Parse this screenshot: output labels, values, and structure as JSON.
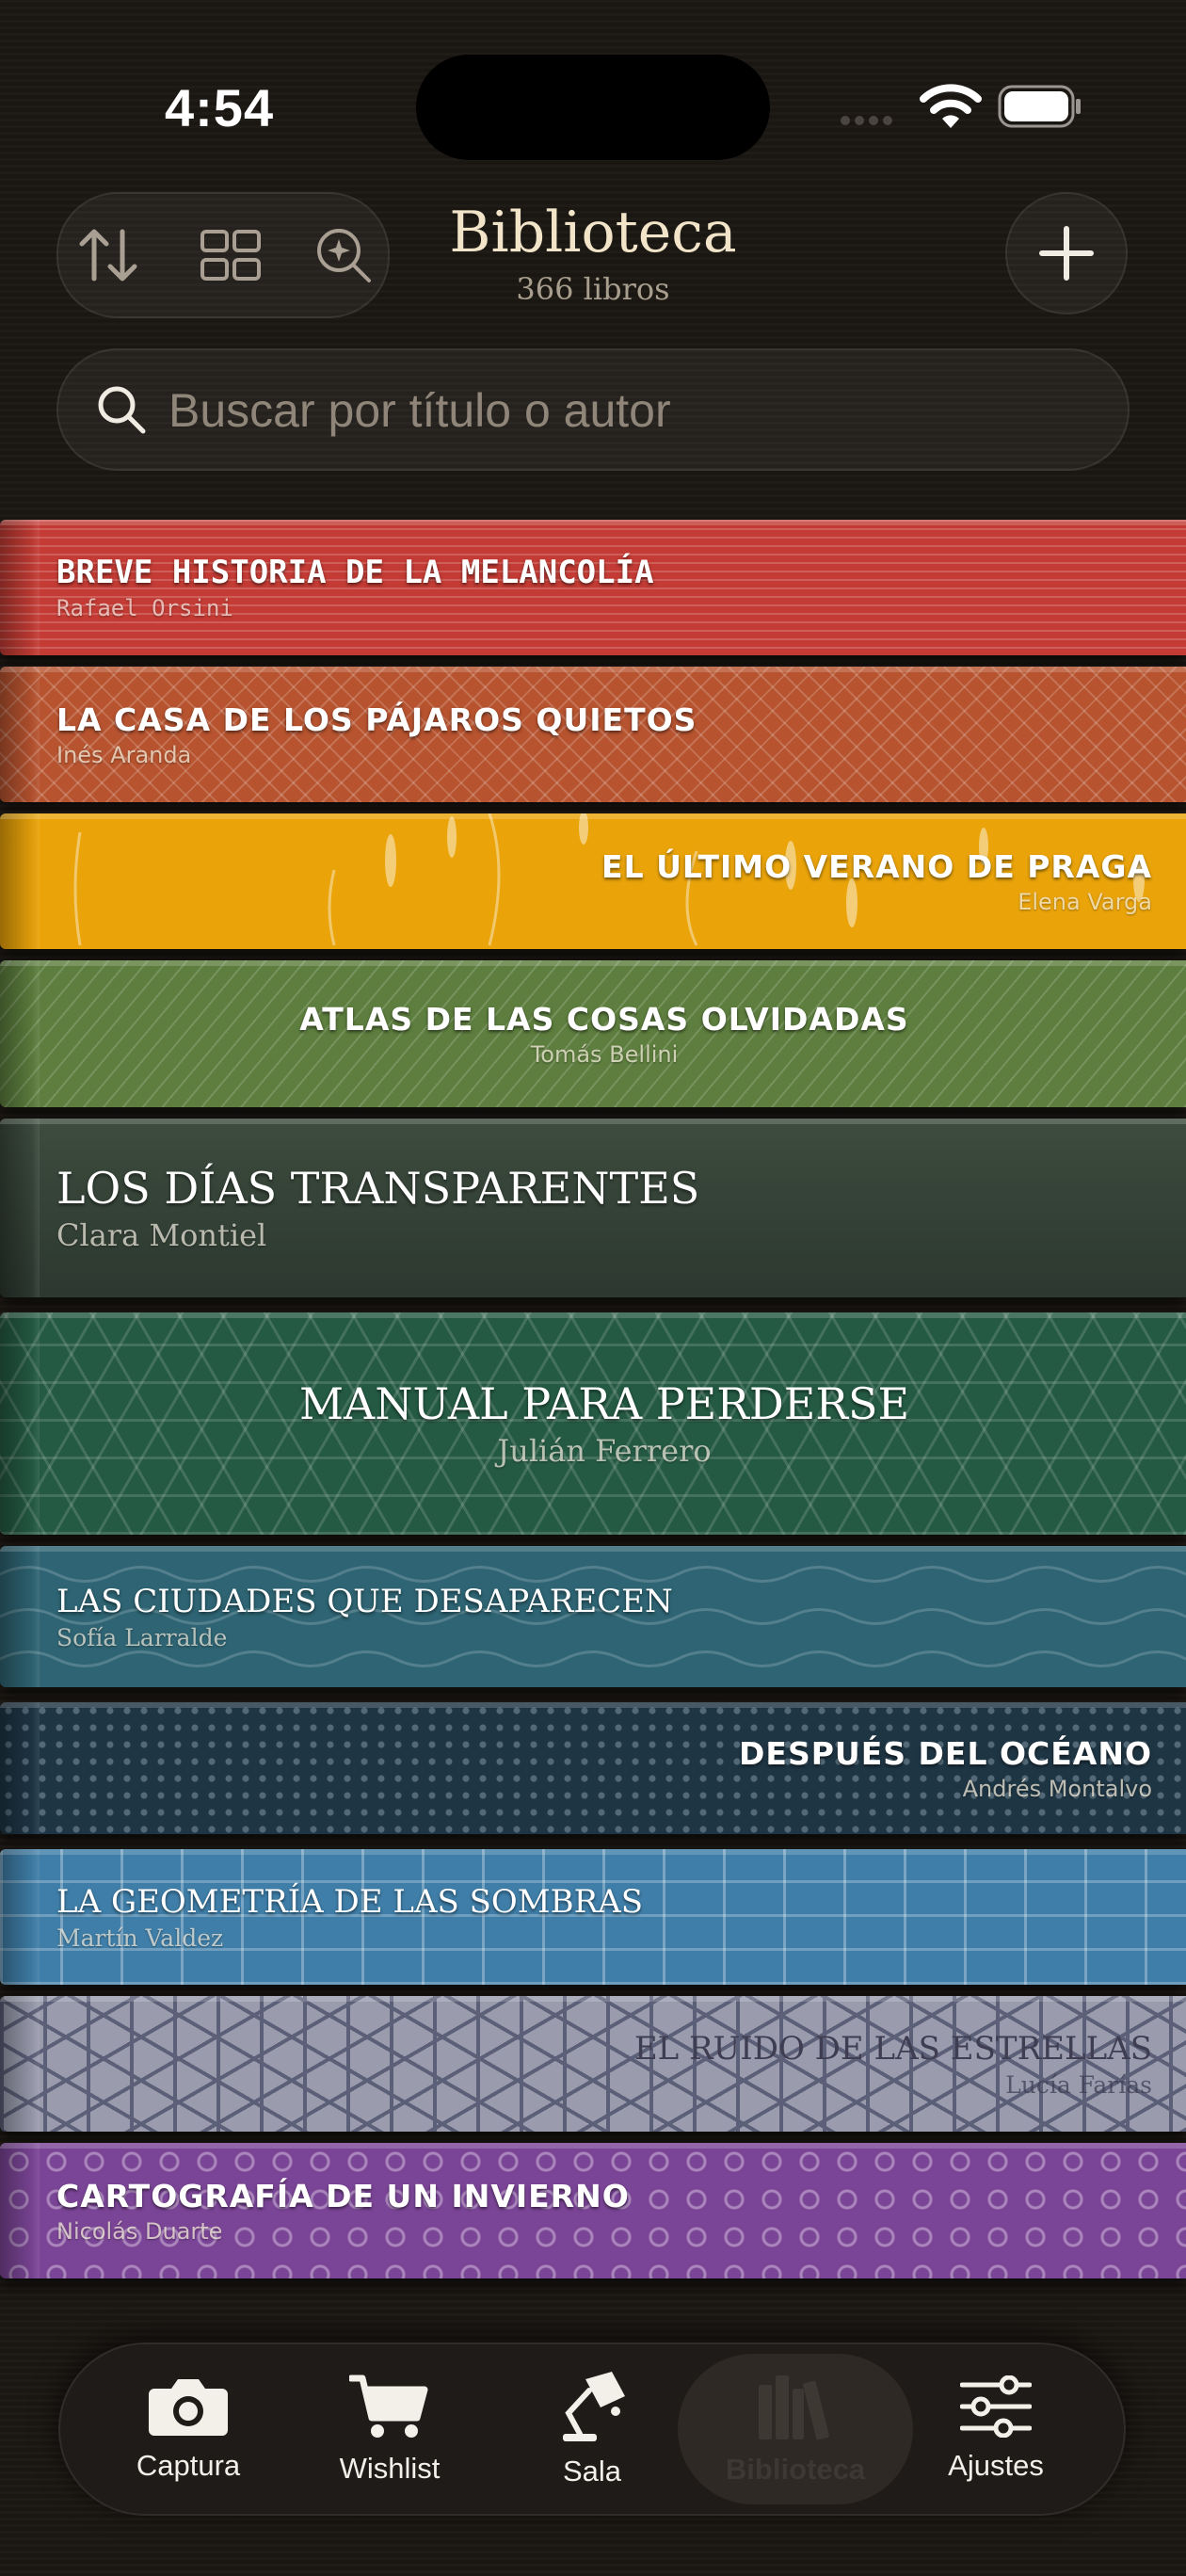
{
  "status_bar": {
    "time": "4:54"
  },
  "header": {
    "title": "Biblioteca",
    "subtitle": "366 libros",
    "tools": [
      "sort-icon",
      "grid-view-icon",
      "zoom-magnify-icon"
    ],
    "add_icon": "plus-icon"
  },
  "search": {
    "placeholder": "Buscar por título o autor",
    "value": ""
  },
  "books": [
    {
      "title": "BREVE HISTORIA DE LA MELANCOLÍA",
      "author": "Rafael Orsini",
      "color": "#c33b34"
    },
    {
      "title": "LA CASA DE LOS PÁJAROS QUIETOS",
      "author": "Inés Aranda",
      "color": "#b7532f"
    },
    {
      "title": "EL ÚLTIMO VERANO DE PRAGA",
      "author": "Elena Varga",
      "color": "#eaa40a"
    },
    {
      "title": "ATLAS DE LAS COSAS OLVIDADAS",
      "author": "Tomás Bellini",
      "color": "#5d7e3e"
    },
    {
      "title": "LOS DÍAS TRANSPARENTES",
      "author": "Clara Montiel",
      "color": "#3d4c3e"
    },
    {
      "title": "MANUAL PARA PERDERSE",
      "author": "Julián Ferrero",
      "color": "#245a43"
    },
    {
      "title": "LAS CIUDADES QUE DESAPARECEN",
      "author": "Sofía Larralde",
      "color": "#2e6473"
    },
    {
      "title": "DESPUÉS DEL OCÉANO",
      "author": "Andrés Montalvo",
      "color": "#1e3544"
    },
    {
      "title": "LA GEOMETRÍA DE LAS SOMBRAS",
      "author": "Martín Valdez",
      "color": "#3f7ea8"
    },
    {
      "title": "EL RUIDO DE LAS ESTRELLAS",
      "author": "Lucía Farías",
      "color": "#9a9cae"
    },
    {
      "title": "CARTOGRAFÍA DE UN INVIERNO",
      "author": "Nicolás Duarte",
      "color": "#7b4597"
    }
  ],
  "tabbar": {
    "items": [
      {
        "label": "Captura",
        "icon": "camera-icon"
      },
      {
        "label": "Wishlist",
        "icon": "cart-icon"
      },
      {
        "label": "Sala",
        "icon": "desk-lamp-icon"
      },
      {
        "label": "Biblioteca",
        "icon": "books-icon",
        "active": true
      },
      {
        "label": "Ajustes",
        "icon": "sliders-icon"
      }
    ]
  }
}
